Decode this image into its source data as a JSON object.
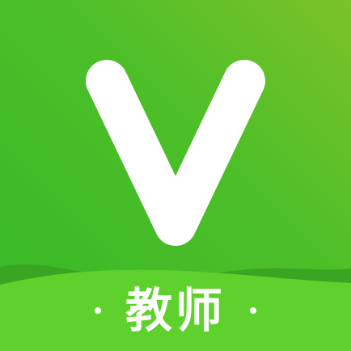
{
  "app_icon": {
    "logo_name": "v-logo",
    "caption": "教师",
    "colors": {
      "gradient_start": "#3fbf2a",
      "gradient_end": "#77c128",
      "band": "#5fd12c",
      "band_shadow": "#3aa522",
      "glyph": "#ffffff"
    }
  }
}
